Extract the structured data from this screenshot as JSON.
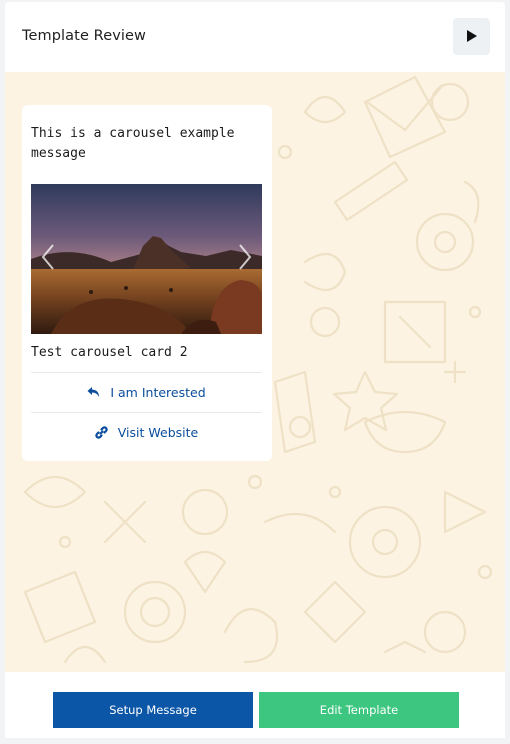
{
  "header": {
    "title": "Template Review",
    "preview_button_icon": "play-icon"
  },
  "message": {
    "body": "This is a carousel example\nmessage"
  },
  "carousel": {
    "card_title": "Test carousel card 2",
    "image": "desert-landscape-photo",
    "prev_icon": "chevron-left-icon",
    "next_icon": "chevron-right-icon",
    "buttons": [
      {
        "label": "I am Interested",
        "icon": "reply-icon"
      },
      {
        "label": "Visit Website",
        "icon": "link-icon"
      }
    ]
  },
  "footer": {
    "setup_label": "Setup Message",
    "edit_label": "Edit Template"
  },
  "colors": {
    "chat_background": "#fcf3e2",
    "link_blue": "#0a4d9c",
    "setup_button": "#0c56a8",
    "edit_button": "#3cc67f"
  }
}
